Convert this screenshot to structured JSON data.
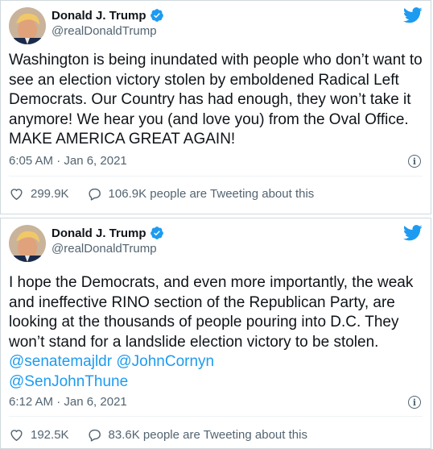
{
  "tweets": [
    {
      "author": {
        "display_name": "Donald J. Trump",
        "handle": "@realDonaldTrump",
        "verified": true,
        "avatar_icon": "profile-photo"
      },
      "text": "Washington is being inundated with people who don’t want to see an election victory stolen by emboldened Radical Left Democrats. Our Country has had enough, they won’t take it anymore! We hear you (and love you) from the Oval Office. MAKE AMERICA GREAT AGAIN!",
      "timestamp": "6:05 AM · Jan 6, 2021",
      "likes": "299.9K",
      "replies_text": "106.9K people are Tweeting about this"
    },
    {
      "author": {
        "display_name": "Donald J. Trump",
        "handle": "@realDonaldTrump",
        "verified": true,
        "avatar_icon": "profile-photo"
      },
      "text_before": "I hope the Democrats, and even more importantly, the weak and ineffective RINO section of the Republican Party, are looking at the thousands of people pouring into D.C. They won’t stand for a landslide election victory to be stolen. ",
      "mentions": [
        "@senatemajldr",
        "@JohnCornyn",
        "@SenJohnThune"
      ],
      "timestamp": "6:12 AM · Jan 6, 2021",
      "likes": "192.5K",
      "replies_text": "83.6K people are Tweeting about this"
    }
  ],
  "icons": {
    "brand": "twitter-bird-icon",
    "verified": "verified-badge-icon",
    "info": "info-icon",
    "like": "heart-icon",
    "reply": "speech-bubble-icon"
  },
  "colors": {
    "accent": "#1d9bf0",
    "text": "#0f1419",
    "muted": "#536471",
    "border": "#cfd9de"
  }
}
